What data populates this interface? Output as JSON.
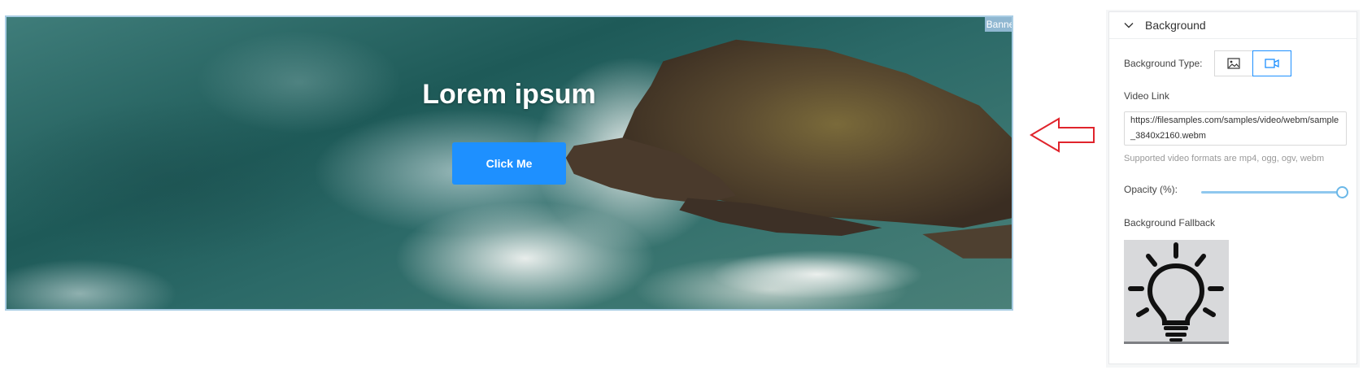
{
  "banner": {
    "tag": "Banner",
    "title": "Lorem ipsum",
    "button_label": "Click Me"
  },
  "panel": {
    "section_title": "Background",
    "background_type_label": "Background Type:",
    "background_type_options": [
      "image-icon",
      "video-icon"
    ],
    "background_type_selected": "video",
    "video_link_label": "Video Link",
    "video_link_value": "https://filesamples.com/samples/video/webm/sample_3840x2160.webm",
    "video_hint": "Supported video formats are mp4, ogg, ogv, webm",
    "opacity_label": "Opacity (%):",
    "opacity_value_fraction": 1.0,
    "fallback_label": "Background Fallback",
    "fallback_image_icon": "lightbulb-icon"
  },
  "colors": {
    "accent": "#1e90ff",
    "banner_border": "#a9cde4",
    "arrow": "#e0242c"
  }
}
